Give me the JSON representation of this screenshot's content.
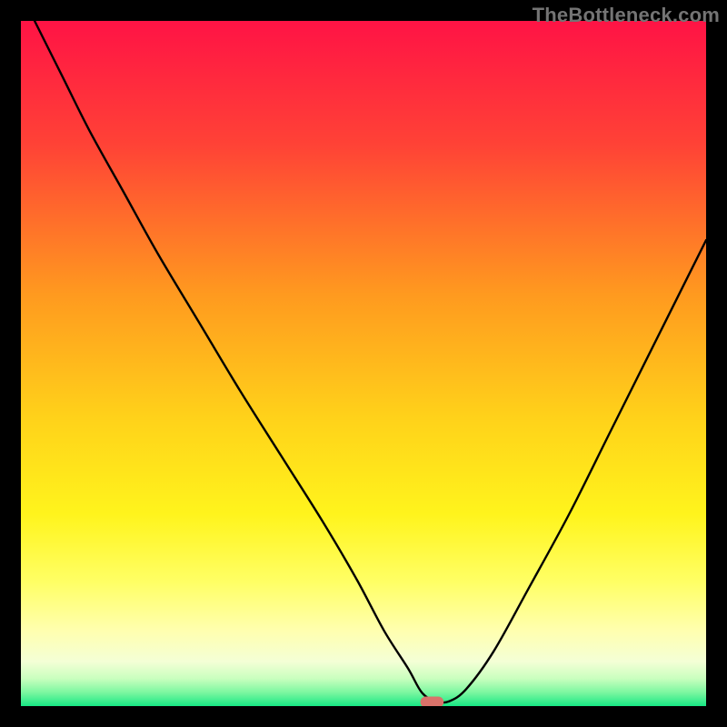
{
  "watermark": "TheBottleneck.com",
  "chart_data": {
    "type": "line",
    "title": "",
    "xlabel": "",
    "ylabel": "",
    "xlim": [
      0,
      100
    ],
    "ylim": [
      0,
      100
    ],
    "gradient_stops": [
      {
        "offset": 0,
        "color": "#ff1345"
      },
      {
        "offset": 18,
        "color": "#ff4236"
      },
      {
        "offset": 40,
        "color": "#ff9a1f"
      },
      {
        "offset": 58,
        "color": "#ffd21a"
      },
      {
        "offset": 72,
        "color": "#fff41c"
      },
      {
        "offset": 82,
        "color": "#ffff66"
      },
      {
        "offset": 89,
        "color": "#ffffaf"
      },
      {
        "offset": 93.5,
        "color": "#f4ffd6"
      },
      {
        "offset": 96,
        "color": "#c9ffbe"
      },
      {
        "offset": 98,
        "color": "#7cf7a0"
      },
      {
        "offset": 100,
        "color": "#17e884"
      }
    ],
    "series": [
      {
        "name": "bottleneck-curve",
        "x": [
          2,
          6,
          10,
          15,
          20,
          26,
          32,
          38,
          44,
          49,
          53,
          56.5,
          58.5,
          60.5,
          62.5,
          65,
          69,
          74,
          80,
          86,
          92,
          98,
          100
        ],
        "y": [
          100,
          92,
          84,
          75,
          66,
          56,
          46,
          36.5,
          27,
          18.5,
          11,
          5.5,
          2,
          0.7,
          0.7,
          2.5,
          8,
          17,
          28,
          40,
          52,
          64,
          68
        ]
      }
    ],
    "marker": {
      "name": "optimal-point",
      "x": 60,
      "y": 0.6,
      "width": 3.4,
      "height": 1.6,
      "color": "#d9726a"
    }
  }
}
